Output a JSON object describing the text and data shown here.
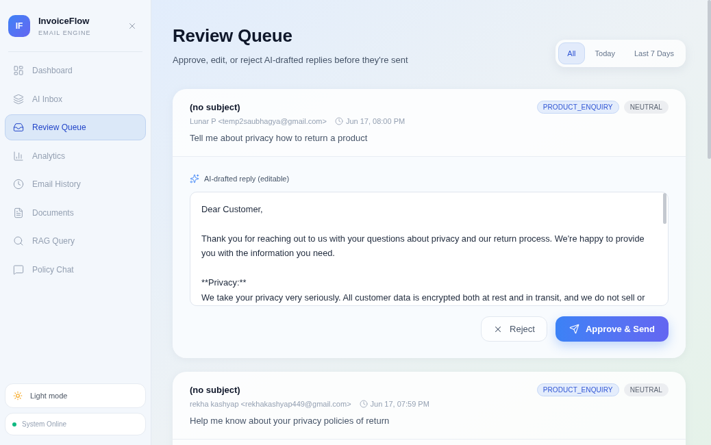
{
  "sidebar": {
    "logo": {
      "initials": "IF",
      "title": "InvoiceFlow",
      "subtitle": "EMAIL ENGINE"
    },
    "items": [
      {
        "label": "Dashboard",
        "selected": false
      },
      {
        "label": "AI Inbox",
        "selected": false
      },
      {
        "label": "Review Queue",
        "selected": true
      },
      {
        "label": "Analytics",
        "selected": false
      },
      {
        "label": "Email History",
        "selected": false
      },
      {
        "label": "Documents",
        "selected": false
      },
      {
        "label": "RAG Query",
        "selected": false
      },
      {
        "label": "Policy Chat",
        "selected": false
      }
    ],
    "theme_toggle": {
      "label": "Light mode"
    },
    "status": {
      "label": "System Online",
      "online": true
    }
  },
  "header": {
    "title": "Review Queue",
    "subtitle": "Approve, edit, or reject AI-drafted replies before they're sent",
    "filters": [
      {
        "label": "All",
        "selected": true
      },
      {
        "label": "Today",
        "selected": false
      },
      {
        "label": "Last 7 Days",
        "selected": false
      }
    ]
  },
  "emails": [
    {
      "subject": "(no subject)",
      "sender": "Lunar P <temp2saubhagya@gmail.com>",
      "time": "Jun 17, 08:00 PM",
      "body": "Tell me about privacy how to return a product",
      "tags": [
        {
          "label": "PRODUCT_ENQUIRY",
          "kind": "category"
        },
        {
          "label": "NEUTRAL",
          "kind": "sentiment"
        }
      ],
      "draft": {
        "label": "AI-drafted reply (editable)",
        "value": "Dear Customer,\n\nThank you for reaching out to us with your questions about privacy and our return process. We're happy to provide you with the information you need.\n\n**Privacy:**\nWe take your privacy very seriously. All customer data is encrypted both at rest and in transit, and we do not sell or"
      },
      "actions": [
        {
          "label": "Reject",
          "kind": "reject"
        },
        {
          "label": "Approve & Send",
          "kind": "approve"
        }
      ]
    },
    {
      "subject": "(no subject)",
      "sender": "rekha kashyap <rekhakashyap449@gmail.com>",
      "time": "Jun 17, 07:59 PM",
      "body": "Help me know about your privacy policies of return",
      "tags": [
        {
          "label": "PRODUCT_ENQUIRY",
          "kind": "category"
        },
        {
          "label": "NEUTRAL",
          "kind": "sentiment"
        }
      ]
    }
  ]
}
